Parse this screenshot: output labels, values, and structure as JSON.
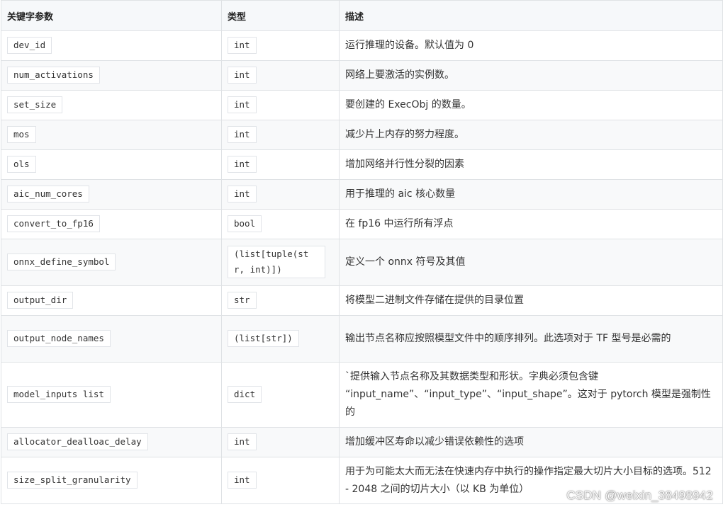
{
  "table": {
    "headers": [
      "关键字参数",
      "类型",
      "描述"
    ],
    "rows": [
      {
        "param": "dev_id",
        "type": "int",
        "desc": "运行推理的设备。默认值为 0"
      },
      {
        "param": "num_activations",
        "type": "int",
        "desc": "网络上要激活的实例数。"
      },
      {
        "param": "set_size",
        "type": "int",
        "desc": "要创建的 ExecObj 的数量。"
      },
      {
        "param": "mos",
        "type": "int",
        "desc": "减少片上内存的努力程度。"
      },
      {
        "param": "ols",
        "type": "int",
        "desc": "增加网络并行性分裂的因素"
      },
      {
        "param": "aic_num_cores",
        "type": "int",
        "desc": "用于推理的 aic 核心数量"
      },
      {
        "param": "convert_to_fp16",
        "type": "bool",
        "desc": "在 fp16 中运行所有浮点"
      },
      {
        "param": "onnx_define_symbol",
        "type": "(list[tuple(str, int)])",
        "desc": "定义一个 onnx 符号及其值"
      },
      {
        "param": "output_dir",
        "type": "str",
        "desc": "将模型二进制文件存储在提供的目录位置"
      },
      {
        "param": "output_node_names",
        "type": "(list[str])",
        "desc": "输出节点名称应按照模型文件中的顺序排列。此选项对于 TF 型号是必需的"
      },
      {
        "param": "model_inputs list",
        "type": "dict",
        "desc": "`提供输入节点名称及其数据类型和形状。字典必须包含键 “input_name”、“input_type”、“input_shape”。这对于 pytorch 模型是强制性的"
      },
      {
        "param": "allocator_dealloac_delay",
        "type": "int",
        "desc": "增加缓冲区寿命以减少错误依赖性的选项"
      },
      {
        "param": "size_split_granularity",
        "type": "int",
        "desc": "用于为可能太大而无法在快速内存中执行的操作指定最大切片大小目标的选项。512 - 2048 之间的切片大小（以 KB 为单位）"
      }
    ]
  },
  "watermark": "CSDN @weixin_38498942"
}
